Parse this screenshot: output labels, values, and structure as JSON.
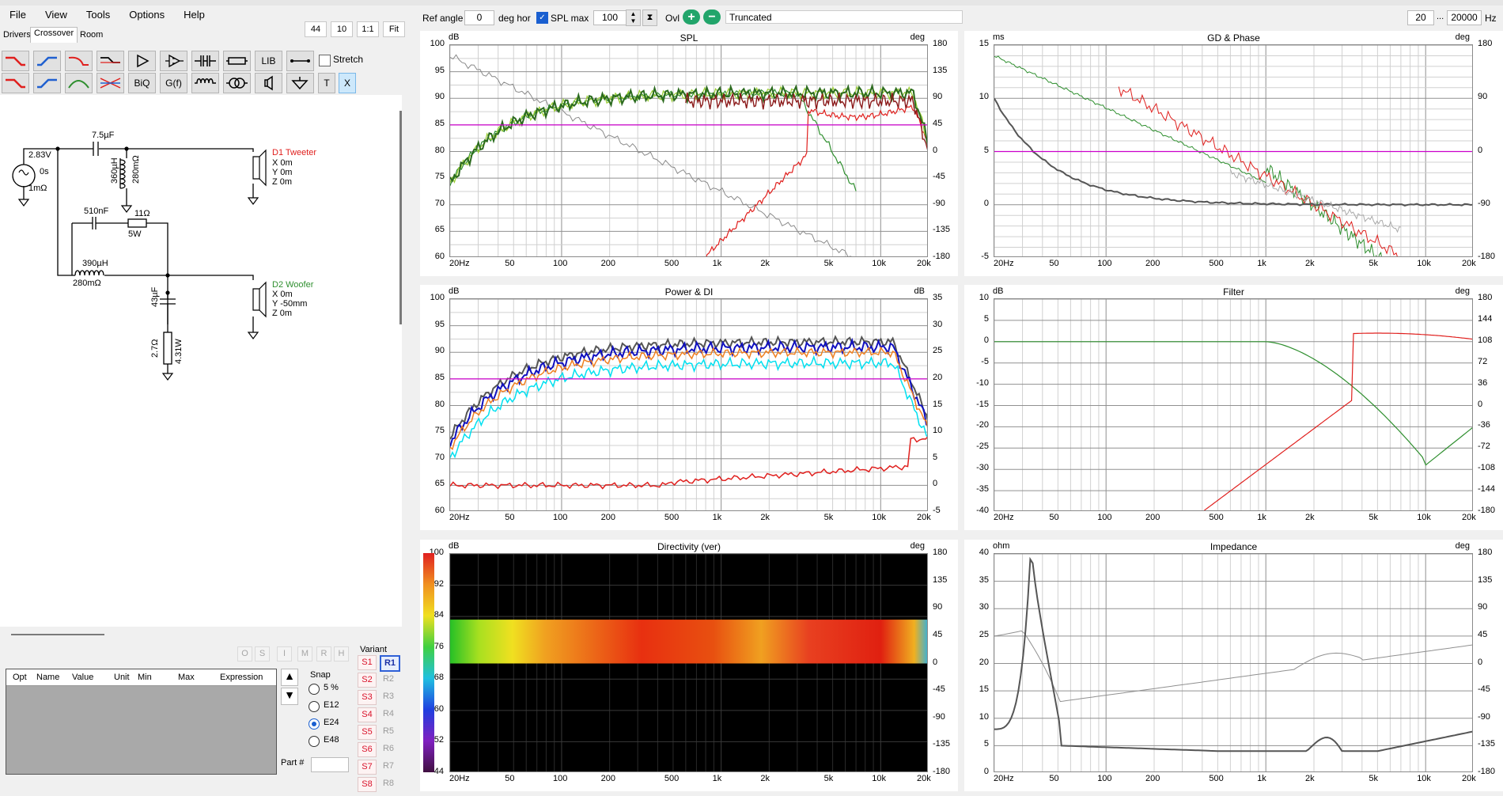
{
  "menu": [
    "File",
    "View",
    "Tools",
    "Options",
    "Help"
  ],
  "zoom_buttons": [
    "44",
    "10",
    "1:1",
    "Fit"
  ],
  "tabs": [
    "Drivers",
    "Crossover",
    "Room"
  ],
  "toolbar": {
    "ref_angle_label": "Ref angle",
    "ref_angle_value": "0",
    "deg_hor_label": "deg hor",
    "spl_max_label": "SPL max",
    "spl_max_value": "100",
    "ovl_label": "Ovl",
    "truncated": "Truncated",
    "freq_min": "20",
    "freq_sep": "...",
    "freq_max": "20000",
    "hz": "Hz"
  },
  "palette": {
    "lib": "LIB",
    "biq": "BiQ",
    "gf": "G(f)",
    "t": "T",
    "x": "X",
    "stretch": "Stretch"
  },
  "schematic": {
    "source_v": "2.83V",
    "source_delay": "0s",
    "source_r": "1mΩ",
    "c1": "7.5µF",
    "l1": "360µH",
    "r1": "280mΩ",
    "c2": "510nF",
    "r2": "11Ω",
    "r2w": "5W",
    "l2": "390µH",
    "r3": "280mΩ",
    "c3": "43µF",
    "r4": "2.7Ω",
    "r4w": "4.31W",
    "d1": {
      "name": "D1 Tweeter",
      "x": "X 0m",
      "y": "Y 0m",
      "z": "Z 0m"
    },
    "d2": {
      "name": "D2 Woofer",
      "x": "X 0m",
      "y": "Y -50mm",
      "z": "Z 0m"
    }
  },
  "wbtns": [
    "O",
    "S",
    "I",
    "M",
    "R",
    "H"
  ],
  "table": {
    "columns": [
      "Opt",
      "Name",
      "Value",
      "Unit",
      "Min",
      "Max",
      "Expression"
    ]
  },
  "snap": {
    "title": "Snap",
    "options": [
      "5 %",
      "E12",
      "E24",
      "E48"
    ],
    "selected": "E24"
  },
  "part_label": "Part #",
  "variant": {
    "title": "Variant",
    "s": [
      "S1",
      "S2",
      "S3",
      "S4",
      "S5",
      "S6",
      "S7",
      "S8"
    ],
    "r": [
      "R1",
      "R2",
      "R3",
      "R4",
      "R5",
      "R6",
      "R7",
      "R8"
    ],
    "selected": "R1"
  },
  "colors": {
    "red": "#e0201e",
    "green": "#2f8f2f",
    "darkgreen": "#2b6a1e",
    "magenta": "#cc00cc",
    "orange": "#f08020",
    "cyan": "#00e0f0",
    "blue": "#1010c0",
    "grey": "#8a8a8a",
    "darkgrey": "#555555"
  },
  "freq_ticks": [
    "20Hz",
    "50",
    "100",
    "200",
    "500",
    "1k",
    "2k",
    "5k",
    "10k",
    "20k"
  ],
  "panels": {
    "spl": {
      "title": "SPL",
      "left_unit": "dB",
      "right_unit": "deg",
      "left_ticks": [
        "100",
        "95",
        "90",
        "85",
        "80",
        "75",
        "70",
        "65",
        "60"
      ],
      "right_ticks": [
        "180",
        "135",
        "90",
        "45",
        "0",
        "-45",
        "-90",
        "-135",
        "-180"
      ]
    },
    "gd": {
      "title": "GD & Phase",
      "left_unit": "ms",
      "right_unit": "deg",
      "left_ticks": [
        "15",
        "10",
        "5",
        "0",
        "-5"
      ],
      "right_ticks": [
        "180",
        "90",
        "0",
        "-90",
        "-180"
      ]
    },
    "power": {
      "title": "Power & DI",
      "left_unit": "dB",
      "right_unit": "dB",
      "left_ticks": [
        "100",
        "95",
        "90",
        "85",
        "80",
        "75",
        "70",
        "65",
        "60"
      ],
      "right_ticks": [
        "35",
        "30",
        "25",
        "20",
        "15",
        "10",
        "5",
        "0",
        "-5"
      ]
    },
    "filter": {
      "title": "Filter",
      "left_unit": "dB",
      "right_unit": "deg",
      "left_ticks": [
        "10",
        "5",
        "0",
        "-5",
        "-10",
        "-15",
        "-20",
        "-25",
        "-30",
        "-35",
        "-40"
      ],
      "right_ticks": [
        "180",
        "144",
        "108",
        "72",
        "36",
        "0",
        "-36",
        "-72",
        "-108",
        "-144",
        "-180"
      ]
    },
    "dir": {
      "title": "Directivity (ver)",
      "left_unit": "dB",
      "right_unit": "deg",
      "left_ticks": [
        "100",
        "92",
        "84",
        "76",
        "68",
        "60",
        "52",
        "44"
      ],
      "right_ticks": [
        "180",
        "135",
        "90",
        "45",
        "0",
        "-45",
        "-90",
        "-135",
        "-180"
      ]
    },
    "imp": {
      "title": "Impedance",
      "left_unit": "ohm",
      "right_unit": "deg",
      "left_ticks": [
        "40",
        "35",
        "30",
        "25",
        "20",
        "15",
        "10",
        "5",
        "0"
      ],
      "right_ticks": [
        "180",
        "135",
        "90",
        "45",
        "0",
        "-45",
        "-90",
        "-135",
        "-180"
      ]
    }
  }
}
